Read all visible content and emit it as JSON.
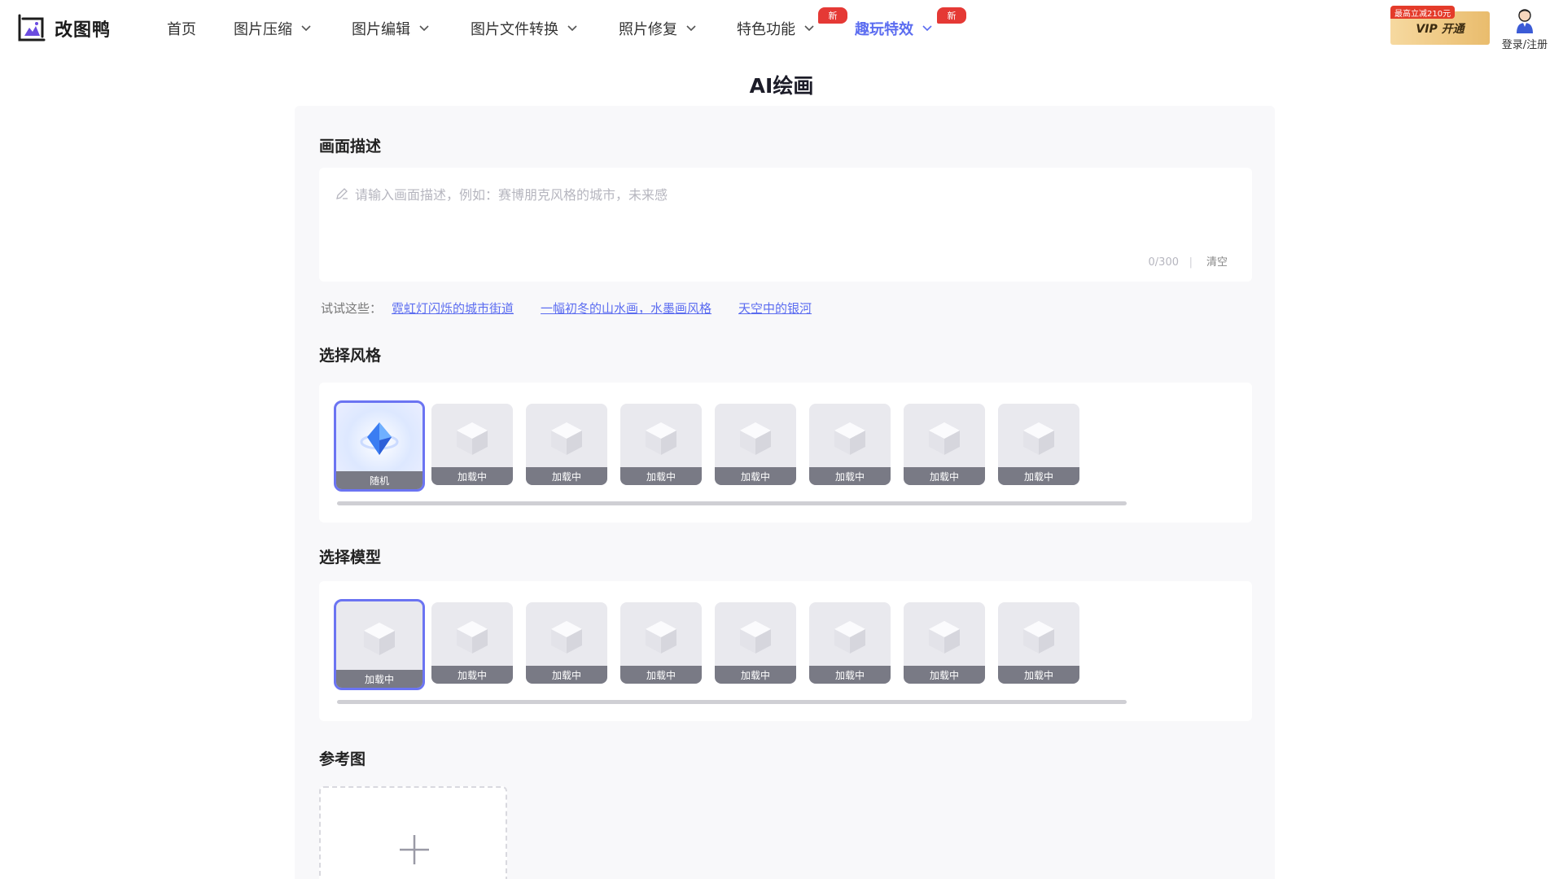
{
  "header": {
    "logo_text": "改图鸭",
    "nav": [
      {
        "label": "首页",
        "dropdown": false,
        "active": false,
        "badge": ""
      },
      {
        "label": "图片压缩",
        "dropdown": true,
        "active": false,
        "badge": ""
      },
      {
        "label": "图片编辑",
        "dropdown": true,
        "active": false,
        "badge": ""
      },
      {
        "label": "图片文件转换",
        "dropdown": true,
        "active": false,
        "badge": ""
      },
      {
        "label": "照片修复",
        "dropdown": true,
        "active": false,
        "badge": ""
      },
      {
        "label": "特色功能",
        "dropdown": true,
        "active": false,
        "badge": "新"
      },
      {
        "label": "趣玩特效",
        "dropdown": true,
        "active": true,
        "badge": "新"
      }
    ],
    "vip_tag": "最高立减210元",
    "vip_label": "VIP 开通",
    "login_label": "登录/注册"
  },
  "page": {
    "title": "AI绘画"
  },
  "description": {
    "title": "画面描述",
    "placeholder": "请输入画面描述，例如：赛博朋克风格的城市，未来感",
    "count": "0/300",
    "separator": "|",
    "clear_label": "清空"
  },
  "suggestions": {
    "label": "试试这些：",
    "items": [
      "霓虹灯闪烁的城市街道",
      "一幅初冬的山水画，水墨画风格",
      "天空中的银河"
    ]
  },
  "style_section": {
    "title": "选择风格",
    "cards": [
      "随机",
      "加载中",
      "加载中",
      "加载中",
      "加载中",
      "加载中",
      "加载中",
      "加载中"
    ],
    "selected_index": 0
  },
  "model_section": {
    "title": "选择模型",
    "cards": [
      "加载中",
      "加载中",
      "加载中",
      "加载中",
      "加载中",
      "加载中",
      "加载中",
      "加载中"
    ],
    "selected_index": 0
  },
  "reference_section": {
    "title": "参考图"
  },
  "colors": {
    "accent": "#5b6cf0",
    "badge_red": "#e53935",
    "vip_gold": "#e9bc6d"
  }
}
